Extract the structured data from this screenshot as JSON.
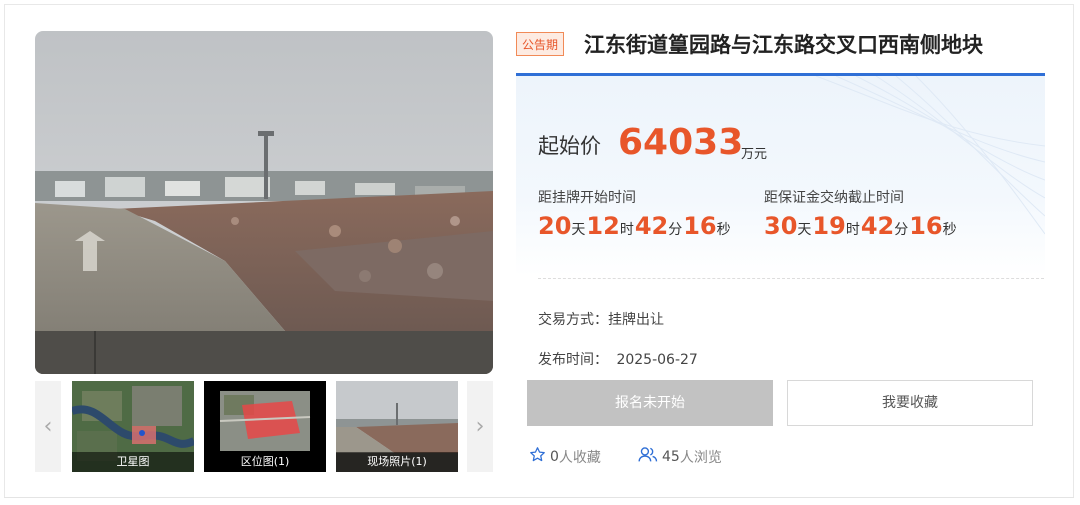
{
  "listing": {
    "status_badge": "公告期",
    "title": "江东街道篁园路与江东路交叉口西南侧地块"
  },
  "gallery": {
    "prev_arrow": "‹",
    "next_arrow": "›",
    "thumbs": [
      {
        "caption": "卫星图"
      },
      {
        "caption": "区位图(1)"
      },
      {
        "caption": "现场照片(1)"
      }
    ]
  },
  "price": {
    "label": "起始价",
    "value": "64033",
    "unit": "万元"
  },
  "countdowns": [
    {
      "label": "距挂牌开始时间",
      "days": "20",
      "hours": "12",
      "minutes": "42",
      "seconds": "16"
    },
    {
      "label": "距保证金交纳截止时间",
      "days": "30",
      "hours": "19",
      "minutes": "42",
      "seconds": "16"
    }
  ],
  "units": {
    "day": "天",
    "hour": "时",
    "minute": "分",
    "second": "秒"
  },
  "details": {
    "trade_method": "交易方式：挂牌出让",
    "publish_label": "发布时间：",
    "publish_date": "2025-06-27"
  },
  "actions": {
    "register_label": "报名未开始",
    "favorite_label": "我要收藏"
  },
  "stats": {
    "favorites_count": "0",
    "favorites_suffix": "人收藏",
    "views_count": "45",
    "views_suffix": "人浏览"
  },
  "colors": {
    "accent_orange": "#e8562a",
    "accent_blue": "#2f6fd6",
    "disabled_gray": "#c2c2c2"
  },
  "icons": {
    "favorite": "star-icon",
    "views": "users-icon",
    "prev": "chevron-left-icon",
    "next": "chevron-right-icon"
  }
}
